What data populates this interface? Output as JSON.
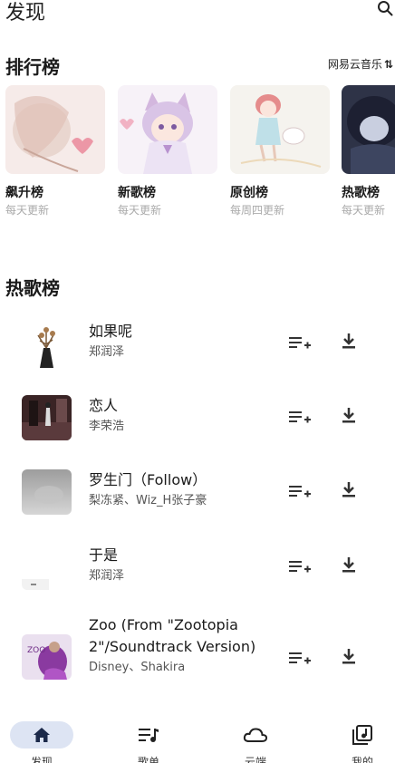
{
  "header": {
    "title": "发现"
  },
  "rank": {
    "title": "排行榜",
    "source": "网易云音乐",
    "charts": [
      {
        "name": "飙升榜",
        "sub": "每天更新"
      },
      {
        "name": "新歌榜",
        "sub": "每天更新"
      },
      {
        "name": "原创榜",
        "sub": "每周四更新"
      },
      {
        "name": "热歌榜",
        "sub": "每天更新"
      }
    ]
  },
  "hot": {
    "title": "热歌榜",
    "songs": [
      {
        "name": "如果呢",
        "artist": "郑润泽"
      },
      {
        "name": "恋人",
        "artist": "李荣浩"
      },
      {
        "name": "罗生门（Follow）",
        "artist": "梨冻紧、Wiz_H张子豪"
      },
      {
        "name": "于是",
        "artist": "郑润泽"
      },
      {
        "name": "Zoo (From \"Zootopia 2\"/Soundtrack Version)",
        "artist": "Disney、Shakira"
      }
    ]
  },
  "nav": {
    "items": [
      {
        "label": "发现"
      },
      {
        "label": "歌单"
      },
      {
        "label": "云端"
      },
      {
        "label": "我的"
      }
    ]
  }
}
